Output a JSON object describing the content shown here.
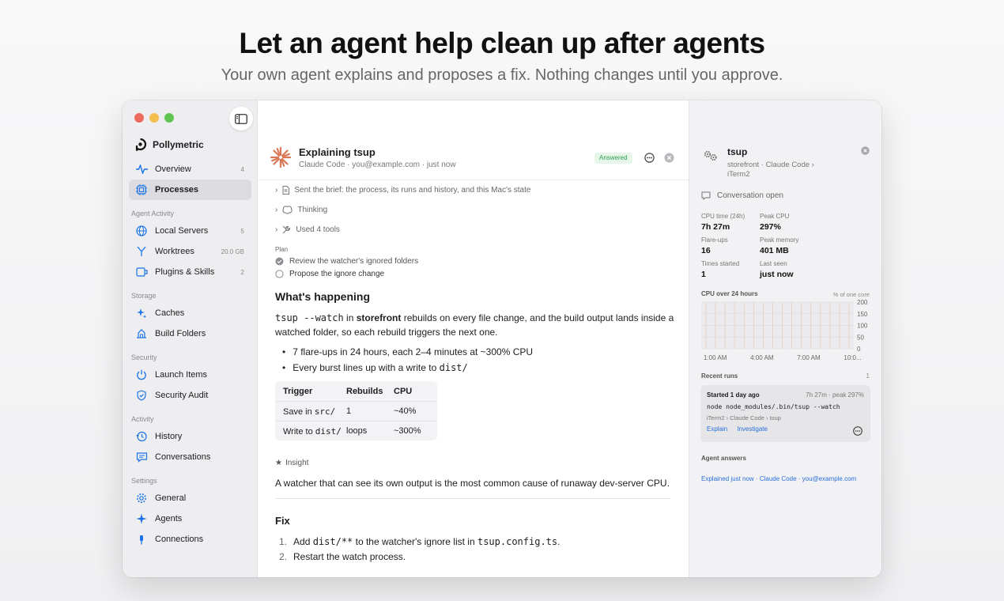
{
  "hero": {
    "title": "Let an agent help clean up after agents",
    "subtitle": "Your own agent explains and proposes a fix. Nothing changes until you approve."
  },
  "sidebar": {
    "brand": "Pollymetric",
    "top_items": [
      {
        "label": "Overview",
        "count": "4",
        "icon": "pulse-icon"
      },
      {
        "label": "Processes",
        "count": "",
        "icon": "cpu-icon",
        "active": true
      }
    ],
    "sections": [
      {
        "title": "Agent Activity",
        "items": [
          {
            "label": "Local Servers",
            "count": "5",
            "icon": "globe-icon"
          },
          {
            "label": "Worktrees",
            "count": "20.0 GB",
            "icon": "branch-icon"
          },
          {
            "label": "Plugins & Skills",
            "count": "2",
            "icon": "plugin-icon"
          }
        ]
      },
      {
        "title": "Storage",
        "items": [
          {
            "label": "Caches",
            "count": "",
            "icon": "sparkles-icon"
          },
          {
            "label": "Build Folders",
            "count": "",
            "icon": "build-icon"
          }
        ]
      },
      {
        "title": "Security",
        "items": [
          {
            "label": "Launch Items",
            "count": "",
            "icon": "power-icon"
          },
          {
            "label": "Security Audit",
            "count": "",
            "icon": "shield-icon"
          }
        ]
      },
      {
        "title": "Activity",
        "items": [
          {
            "label": "History",
            "count": "",
            "icon": "clock-icon"
          },
          {
            "label": "Conversations",
            "count": "",
            "icon": "chat-icon"
          }
        ]
      },
      {
        "title": "Settings",
        "items": [
          {
            "label": "General",
            "count": "",
            "icon": "gear-icon"
          },
          {
            "label": "Agents",
            "count": "",
            "icon": "star-icon"
          },
          {
            "label": "Connections",
            "count": "",
            "icon": "plug-icon"
          }
        ]
      }
    ]
  },
  "main": {
    "title": "Explaining tsup",
    "meta": "Claude Code · you@example.com · just now",
    "badge": "Answered",
    "steps": [
      "Sent the brief: the process, its runs and history, and this Mac's state",
      "Thinking",
      "Used 4 tools"
    ],
    "plan_label": "Plan",
    "plan": [
      {
        "text": "Review the watcher's ignored folders",
        "done": true
      },
      {
        "text": "Propose the ignore change",
        "done": false
      }
    ],
    "happening_title": "What's happening",
    "para": {
      "code1": "tsup --watch",
      "t1": " in ",
      "bold1": "storefront",
      "t2": " rebuilds on every file change, and the build output lands inside a watched folder, so each rebuild triggers the next one."
    },
    "bullets": {
      "b1": "7 flare-ups in 24 hours, each 2–4 minutes at ~300% CPU",
      "b2_text": "Every burst lines up with a write to ",
      "b2_code": "dist/"
    },
    "table": {
      "headers": [
        "Trigger",
        "Rebuilds",
        "CPU"
      ],
      "rows": [
        {
          "trigger_text": "Save in ",
          "trigger_code": "src/",
          "rebuilds": "1",
          "cpu": "~40%"
        },
        {
          "trigger_text": "Write to ",
          "trigger_code": "dist/",
          "rebuilds": "loops",
          "cpu": "~300%"
        }
      ]
    },
    "insight_label": "Insight",
    "insight_text": "A watcher that can see its own output is the most common cause of runaway dev-server CPU.",
    "fix_title": "Fix",
    "fix1": {
      "n": "1.",
      "t1": "Add ",
      "code1": "dist/**",
      "t2": " to the watcher's ignore list in ",
      "code2": "tsup.config.ts",
      "t3": "."
    },
    "fix2": {
      "n": "2.",
      "text": "Restart the watch process."
    }
  },
  "panel": {
    "title": "tsup",
    "subtitle": "storefront · Claude Code › iTerm2",
    "conversation": "Conversation open",
    "stats": [
      {
        "label": "CPU time (24h)",
        "value": "7h 27m"
      },
      {
        "label": "Peak CPU",
        "value": "297%"
      },
      {
        "label": "Flare-ups",
        "value": "16"
      },
      {
        "label": "Peak memory",
        "value": "401 MB"
      },
      {
        "label": "Times started",
        "value": "1"
      },
      {
        "label": "Last seen",
        "value": "just now"
      }
    ],
    "chart_label": "CPU over 24 hours",
    "chart_unit": "% of one core",
    "recent_label": "Recent runs",
    "recent_count": "1",
    "run": {
      "started": "Started 1 day ago",
      "summary": "7h 27m · peak 297%",
      "command": "node node_modules/.bin/tsup --watch",
      "path": "iTerm2 › Claude Code › tsup",
      "explain": "Explain",
      "investigate": "Investigate"
    },
    "agent_label": "Agent answers",
    "agent_line": "Explained just now · Claude Code · you@example.com"
  },
  "chart_data": {
    "type": "line",
    "title": "CPU over 24 hours",
    "ylabel": "% of one core",
    "x_ticks": [
      "1:00 AM",
      "4:00 AM",
      "7:00 AM",
      "10:0..."
    ],
    "y_ticks": [
      200,
      150,
      100,
      50,
      0
    ],
    "ylim": [
      0,
      200
    ],
    "grid": true,
    "spikes": 16
  }
}
